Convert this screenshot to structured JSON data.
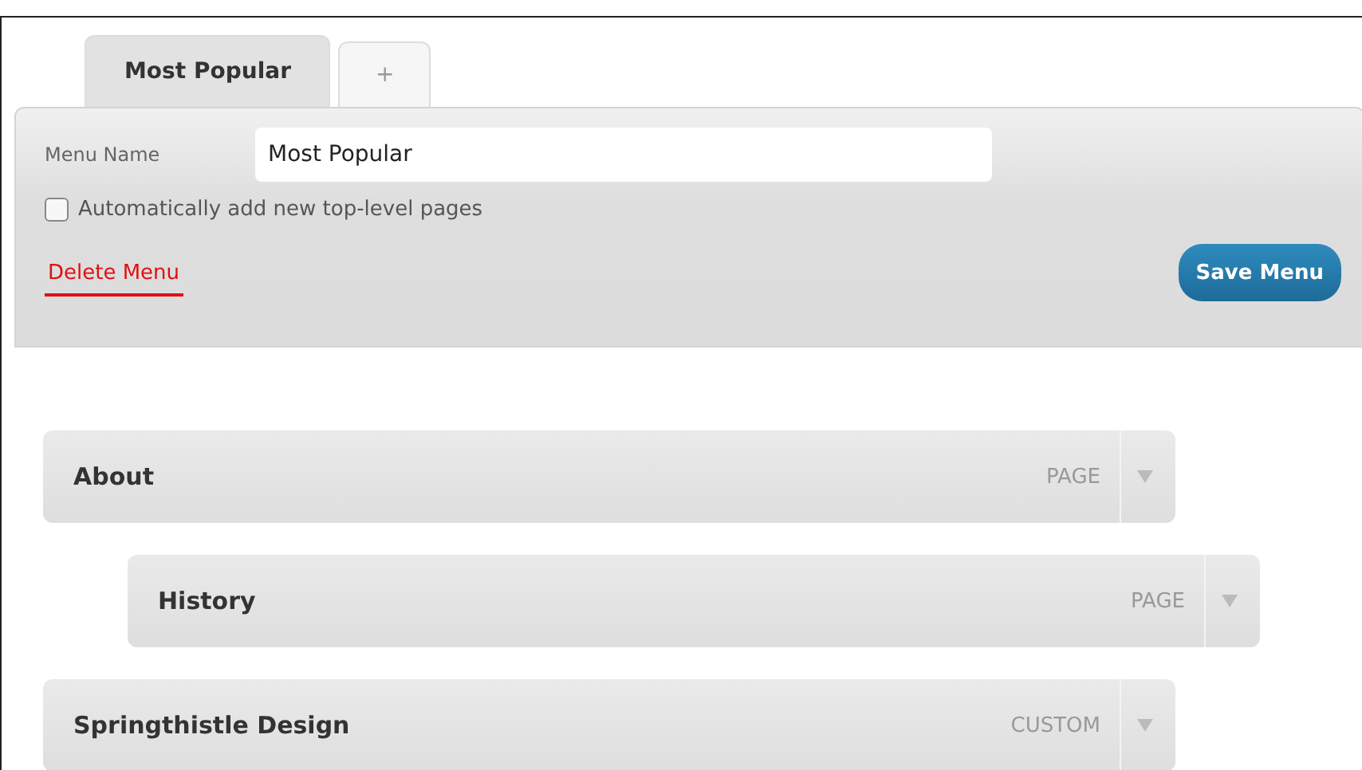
{
  "tabs": [
    {
      "label": "Most Popular",
      "selected": true
    },
    {
      "label": "+",
      "selected": false
    }
  ],
  "menu_name": {
    "label": "Menu Name",
    "value": "Most Popular"
  },
  "auto_add": {
    "label": "Automatically add new top-level pages",
    "checked": false
  },
  "delete_link": "Delete Menu",
  "save_button": "Save Menu",
  "menu_items": [
    {
      "title": "About",
      "type": "PAGE",
      "children": [
        {
          "title": "History",
          "type": "PAGE"
        }
      ]
    },
    {
      "title": "Springthistle Design",
      "type": "CUSTOM"
    }
  ]
}
